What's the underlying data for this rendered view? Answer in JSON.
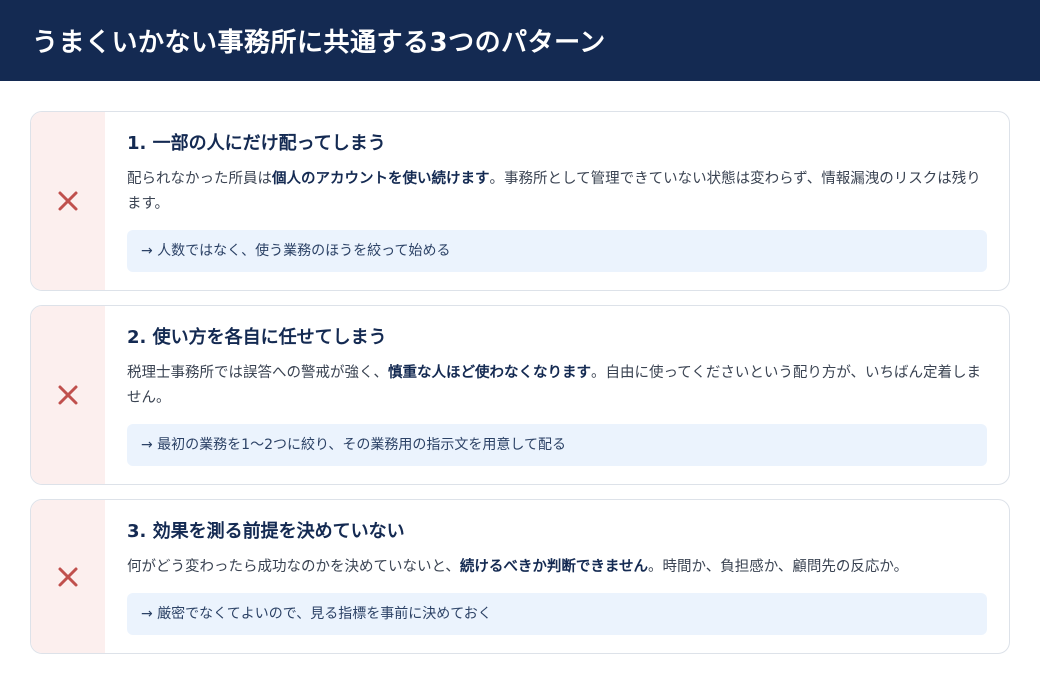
{
  "header": {
    "title": "うまくいかない事務所に共通する3つのパターン"
  },
  "colors": {
    "header_bg": "#142a52",
    "mark_bg": "#fcefee",
    "x_mark": "#c0504d",
    "tip_bg": "#ebf3fd"
  },
  "patterns": [
    {
      "icon": "x-mark-icon",
      "title": "1. 一部の人にだけ配ってしまう",
      "text_before": "配られなかった所員は",
      "text_bold": "個人のアカウントを使い続けます",
      "text_after": "。事務所として管理できていない状態は変わらず、情報漏洩のリスクは残ります。",
      "tip": "→ 人数ではなく、使う業務のほうを絞って始める"
    },
    {
      "icon": "x-mark-icon",
      "title": "2. 使い方を各自に任せてしまう",
      "text_before": "税理士事務所では誤答への警戒が強く、",
      "text_bold": "慎重な人ほど使わなくなります",
      "text_after": "。自由に使ってくださいという配り方が、いちばん定着しません。",
      "tip": "→ 最初の業務を1〜2つに絞り、その業務用の指示文を用意して配る"
    },
    {
      "icon": "x-mark-icon",
      "title": "3. 効果を測る前提を決めていない",
      "text_before": "何がどう変わったら成功なのかを決めていないと、",
      "text_bold": "続けるべきか判断できません",
      "text_after": "。時間か、負担感か、顧問先の反応か。",
      "tip": "→ 厳密でなくてよいので、見る指標を事前に決めておく"
    }
  ]
}
